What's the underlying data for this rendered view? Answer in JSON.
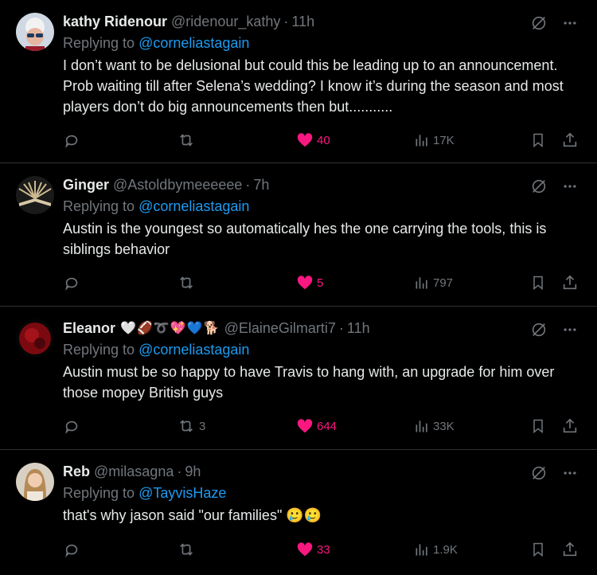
{
  "tweets": [
    {
      "name": "kathy Ridenour",
      "handle": "@ridenour_kathy",
      "time": "11h",
      "reply_prefix": "Replying to",
      "reply_to": "@corneliastagain",
      "text": "I don’t want to be delusional but could this be leading up to an announcement. Prob waiting till after Selena’s wedding? I know it’s during the season and most players don’t do big announcements then but...........",
      "replies": "",
      "retweets": "",
      "likes": "40",
      "views": "17K"
    },
    {
      "name": "Ginger",
      "handle": "@Astoldbymeeeeee",
      "time": "7h",
      "reply_prefix": "Replying to",
      "reply_to": "@corneliastagain",
      "text": "Austin is the youngest so automatically hes the one carrying the tools, this is siblings behavior",
      "replies": "",
      "retweets": "",
      "likes": "5",
      "views": "797"
    },
    {
      "name": "Eleanor",
      "name_emojis": "🤍🏈➰💖💙🐕",
      "handle": "@ElaineGilmarti7",
      "time": "11h",
      "reply_prefix": "Replying to",
      "reply_to": "@corneliastagain",
      "text": "Austin must be so happy to have Travis to hang with, an upgrade for him over those mopey British guys",
      "replies": "",
      "retweets": "3",
      "likes": "644",
      "views": "33K"
    },
    {
      "name": "Reb",
      "handle": "@milasagna",
      "time": "9h",
      "reply_prefix": "Replying to",
      "reply_to": "@TayvisHaze",
      "text": "that's why jason said \"our families\" 🥲🥲",
      "replies": "",
      "retweets": "",
      "likes": "33",
      "views": "1.9K"
    }
  ],
  "dot": "·",
  "colors": {
    "like": "#f91880",
    "mention": "#1d9bf0",
    "muted": "#71767b"
  }
}
